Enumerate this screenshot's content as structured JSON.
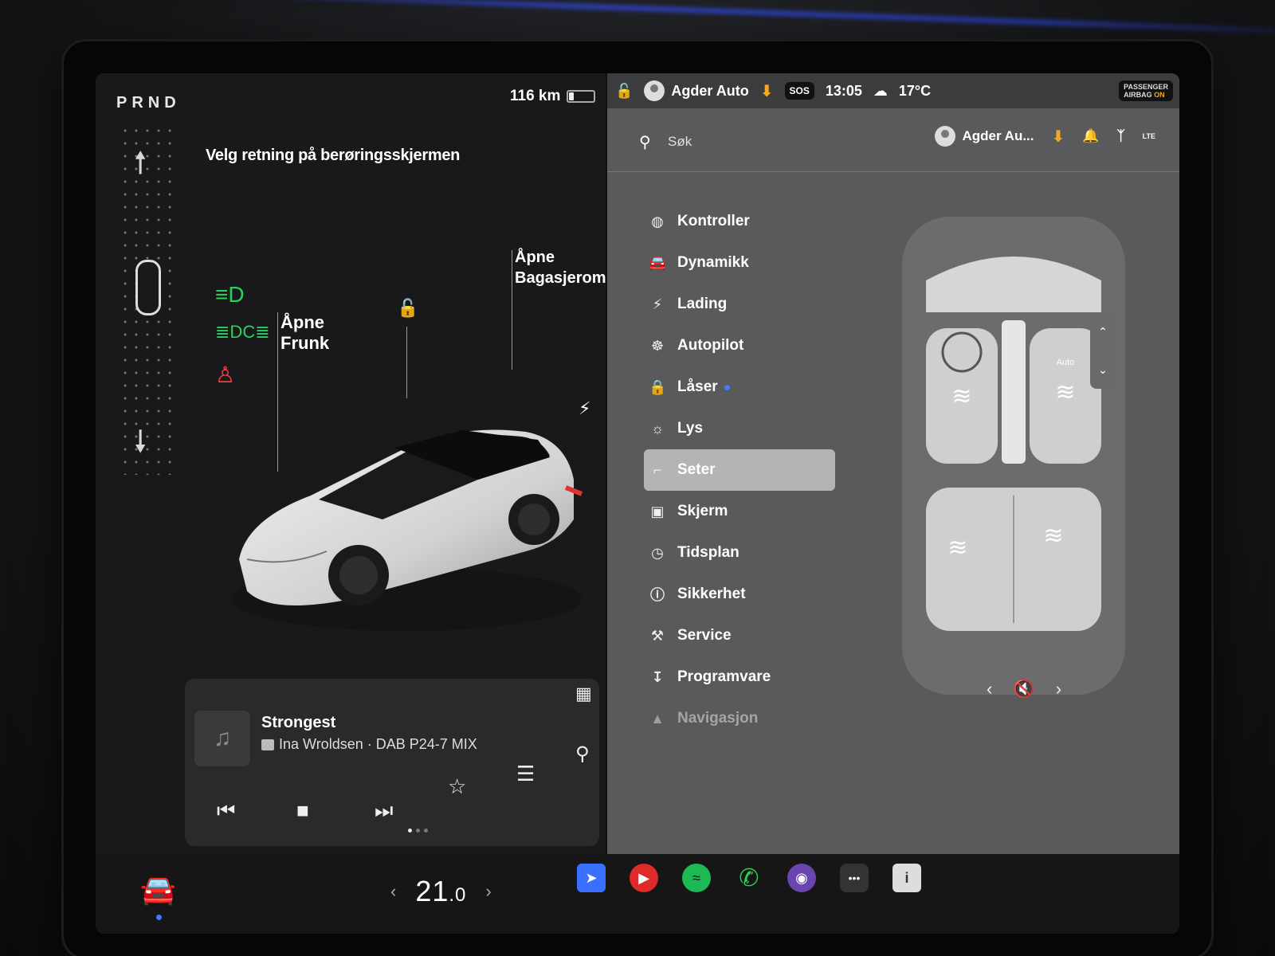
{
  "left_panel": {
    "gear_letters": "PRND",
    "range": "116 km",
    "battery_level_pct": 20,
    "direction_hint": "Velg retning på berøringsskjermen",
    "frunk_label_line1": "Åpne",
    "frunk_label_line2": "Frunk",
    "trunk_label_line1": "Åpne",
    "trunk_label_line2": "Bagasjerom",
    "telltales": [
      "headlight-icon",
      "parking-light-icon",
      "seatbelt-warning-icon"
    ]
  },
  "media": {
    "title": "Strongest",
    "subtitle": "Ina Wroldsen · DAB P24-7 MIX"
  },
  "status_bar": {
    "profile": "Agder Auto",
    "sos": "SOS",
    "time": "13:05",
    "temperature": "17°C",
    "airbag_line1": "PASSENGER",
    "airbag_line2": "AIRBAG",
    "airbag_state": "ON"
  },
  "settings": {
    "search_placeholder": "Søk",
    "profile_short": "Agder Au...",
    "network": "LTE",
    "menu": [
      {
        "label": "Kontroller",
        "icon": "toggle-icon"
      },
      {
        "label": "Dynamikk",
        "icon": "car-icon"
      },
      {
        "label": "Lading",
        "icon": "bolt-icon"
      },
      {
        "label": "Autopilot",
        "icon": "steering-wheel-icon"
      },
      {
        "label": "Låser",
        "icon": "lock-icon"
      },
      {
        "label": "Lys",
        "icon": "sun-icon"
      },
      {
        "label": "Seter",
        "icon": "seat-icon"
      },
      {
        "label": "Skjerm",
        "icon": "display-icon"
      },
      {
        "label": "Tidsplan",
        "icon": "clock-icon"
      },
      {
        "label": "Sikkerhet",
        "icon": "alert-icon"
      },
      {
        "label": "Service",
        "icon": "wrench-icon"
      },
      {
        "label": "Programvare",
        "icon": "download-icon"
      },
      {
        "label": "Navigasjon",
        "icon": "navigation-icon"
      }
    ],
    "active_item": "Seter",
    "seat_heater_badge": "Auto"
  },
  "dock": {
    "temp_whole": "21",
    "temp_decimal": ".0"
  },
  "colors": {
    "accent_blue": "#3d7bff",
    "download_orange": "#f5a623",
    "telltale_green": "#28d35b",
    "telltale_red": "#ff3b3b"
  }
}
